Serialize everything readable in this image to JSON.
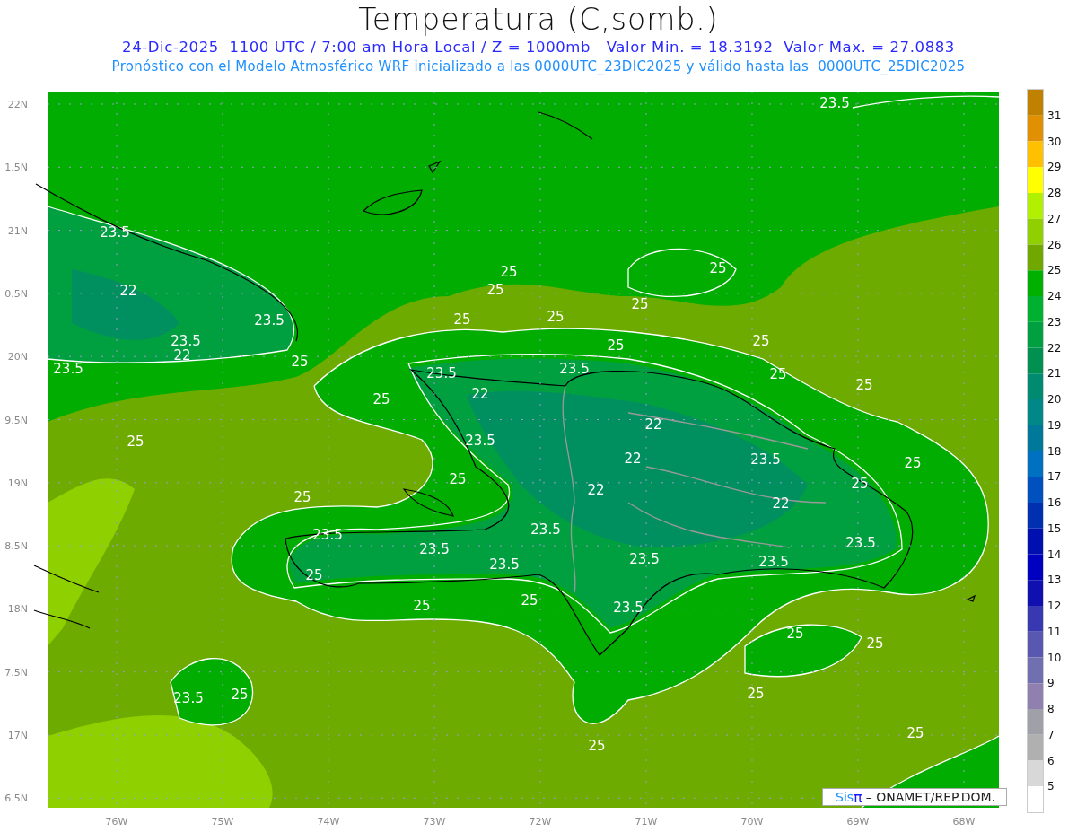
{
  "title": "Temperatura (C,somb.)",
  "subtitle": "24-Dic-2025  1100 UTC / 7:00 am Hora Local / Z = 1000mb   Valor Min. = 18.3192  Valor Max. = 27.0883",
  "description": "Pronóstico con el Modelo Atmosférico WRF inicializado a las 0000UTC_23DIC2025 y válido hasta las  0000UTC_25DIC2025",
  "map": {
    "x_ticks": [
      "76W",
      "75W",
      "74W",
      "73W",
      "72W",
      "71W",
      "70W",
      "69W",
      "68W"
    ],
    "y_ticks": [
      "22N",
      "1.5N",
      "21N",
      "0.5N",
      "20N",
      "9.5N",
      "19N",
      "8.5N",
      "18N",
      "7.5N",
      "17N",
      "6.5N"
    ],
    "contour_labels": [
      "23.5",
      "23.5",
      "22",
      "23.5",
      "23.5",
      "22",
      "23.5",
      "25",
      "25",
      "25",
      "25",
      "25",
      "25",
      "25",
      "23.5",
      "25",
      "23.5",
      "22",
      "25",
      "25",
      "25",
      "25",
      "22",
      "25",
      "23.5",
      "22",
      "25",
      "23.5",
      "25",
      "22",
      "25",
      "22",
      "25",
      "23.5",
      "23.5",
      "23.5",
      "23.5",
      "25",
      "23.5",
      "23.5",
      "25",
      "23.5",
      "25",
      "23.5",
      "25",
      "25",
      "23.5",
      "25",
      "25",
      "25",
      "25"
    ]
  },
  "colorbar": {
    "bands": [
      {
        "color": "#c08000"
      },
      {
        "color": "#e09000"
      },
      {
        "color": "#ffc000"
      },
      {
        "color": "#ffff00"
      },
      {
        "color": "#b0f000"
      },
      {
        "color": "#90d000"
      },
      {
        "color": "#70a800"
      },
      {
        "color": "#00b000"
      },
      {
        "color": "#00b030"
      },
      {
        "color": "#00a040"
      },
      {
        "color": "#009050"
      },
      {
        "color": "#008a70"
      },
      {
        "color": "#008888"
      },
      {
        "color": "#00789a"
      },
      {
        "color": "#0070c0"
      },
      {
        "color": "#0050c0"
      },
      {
        "color": "#0030b0"
      },
      {
        "color": "#0010b0"
      },
      {
        "color": "#0000c0"
      },
      {
        "color": "#1010b0"
      },
      {
        "color": "#3838b0"
      },
      {
        "color": "#5858b0"
      },
      {
        "color": "#7070b0"
      },
      {
        "color": "#9080b0"
      },
      {
        "color": "#a0a0a8"
      },
      {
        "color": "#b0b0b0"
      },
      {
        "color": "#d8d8d8"
      },
      {
        "color": "#ffffff"
      }
    ],
    "labels": [
      "31",
      "30",
      "29",
      "28",
      "27",
      "26",
      "25",
      "24",
      "23",
      "22",
      "21",
      "20",
      "19",
      "18",
      "17",
      "16",
      "15",
      "14",
      "13",
      "12",
      "11",
      "10",
      "9",
      "8",
      "7",
      "6",
      "5"
    ]
  },
  "credit": {
    "logo_prefix": "Sis",
    "logo_symbol": "π",
    "text": "– ONAMET/REP.DOM."
  }
}
